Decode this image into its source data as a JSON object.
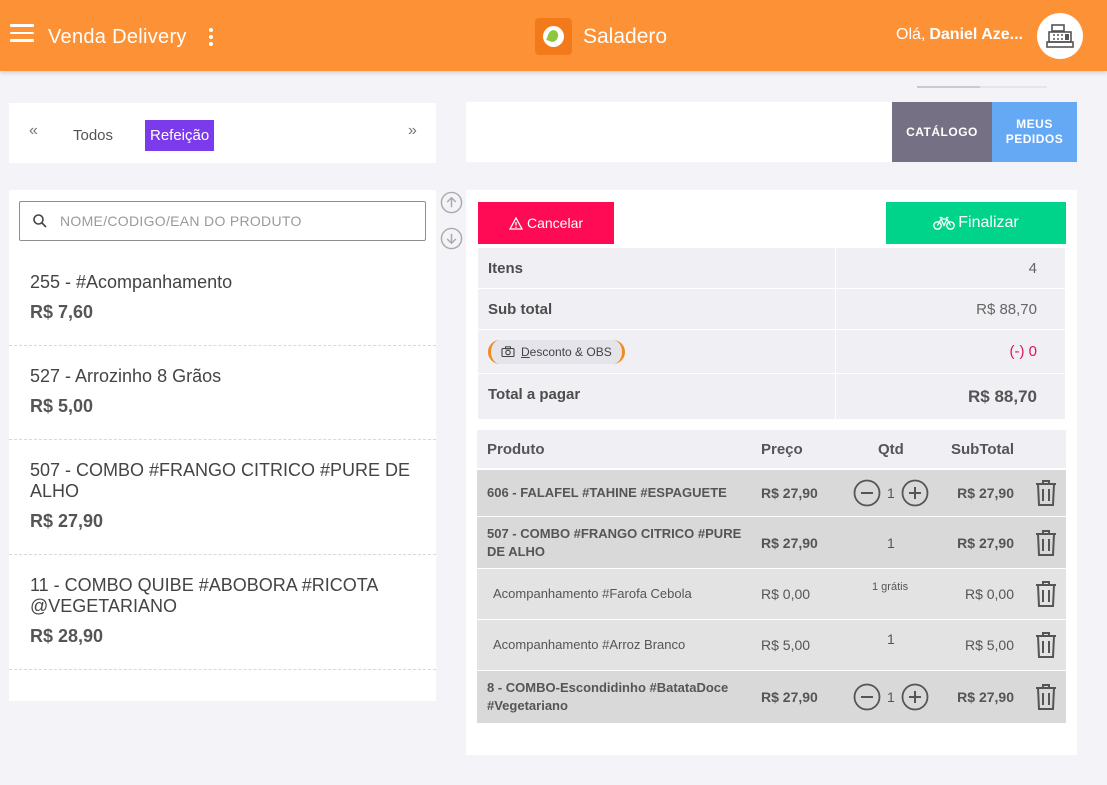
{
  "header": {
    "app_title": "Venda Delivery",
    "brand_name": "Saladero",
    "greeting": "Olá,",
    "user_name": "Daniel Aze..."
  },
  "categories": {
    "tabs": [
      "Todos",
      "Refeição"
    ],
    "active": "Refeição"
  },
  "top_tabs": {
    "catalog": "CATÁLOGO",
    "orders": "MEUS PEDIDOS"
  },
  "search": {
    "placeholder": "NOME/CODIGO/EAN DO PRODUTO"
  },
  "products": [
    {
      "name": "255 - #Acompanhamento",
      "price": "R$ 7,60"
    },
    {
      "name": "527 - Arrozinho 8 Grãos",
      "price": "R$ 5,00"
    },
    {
      "name": "507 - COMBO #FRANGO CITRICO #PURE DE ALHO",
      "price": "R$ 27,90"
    },
    {
      "name": "11 - COMBO QUIBE #ABOBORA #RICOTA @VEGETARIANO",
      "price": "R$ 28,90"
    }
  ],
  "order": {
    "cancel_label": "Cancelar",
    "finish_label": "Finalizar",
    "summary": {
      "items_label": "Itens",
      "items_value": "4",
      "subtotal_label": "Sub total",
      "subtotal_value": "R$ 88,70",
      "discount_btn_first": "D",
      "discount_btn_rest": "esconto & OBS",
      "discount_value": "(-) 0",
      "total_label": "Total a pagar",
      "total_value": "R$ 88,70"
    },
    "columns": {
      "product": "Produto",
      "price": "Preço",
      "qty": "Qtd",
      "subtotal": "SubTotal"
    },
    "items": [
      {
        "name": "606 - FALAFEL #TAHINE #ESPAGUETE",
        "price": "R$ 27,90",
        "qty": "1",
        "subtotal": "R$ 27,90"
      },
      {
        "name": "507 - COMBO #FRANGO CITRICO #PURE DE ALHO",
        "price": "R$ 27,90",
        "qty": "1",
        "subtotal": "R$ 27,90"
      },
      {
        "name": "Acompanhamento #Farofa Cebola",
        "price": "R$ 0,00",
        "qty": "1 grátis",
        "subtotal": "R$ 0,00"
      },
      {
        "name": "Acompanhamento #Arroz Branco",
        "price": "R$ 5,00",
        "qty": "1",
        "subtotal": "R$ 5,00"
      },
      {
        "name": "8 - COMBO-Escondidinho #BatataDoce #Vegetariano",
        "price": "R$ 27,90",
        "qty": "1",
        "subtotal": "R$ 27,90"
      }
    ]
  },
  "colors": {
    "header": "#fd9135",
    "active_tab": "#7c3aed",
    "cancel": "#ff0a54",
    "finish": "#00d38a",
    "orders_tab": "#65a9f5",
    "catalog_tab": "#767085"
  }
}
